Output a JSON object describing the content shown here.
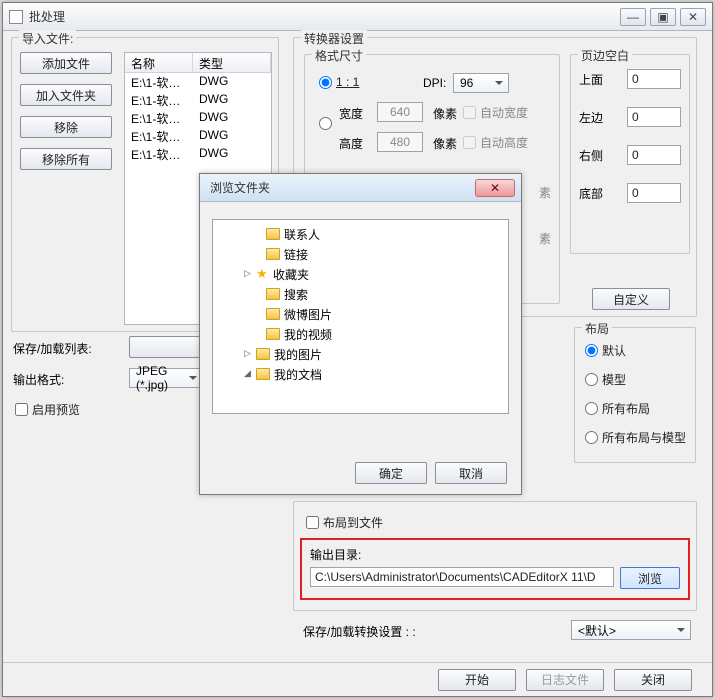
{
  "window": {
    "title": "批处理",
    "btn_min": "—",
    "btn_max": "▣",
    "btn_close": "✕"
  },
  "import": {
    "legend": "导入文件:",
    "btn_add_file": "添加文件",
    "btn_add_folder": "加入文件夹",
    "btn_remove": "移除",
    "btn_remove_all": "移除所有"
  },
  "table": {
    "col_name": "名称",
    "col_type": "类型",
    "rows": [
      {
        "name": "E:\\1-软文...",
        "type": "DWG"
      },
      {
        "name": "E:\\1-软文...",
        "type": "DWG"
      },
      {
        "name": "E:\\1-软文...",
        "type": "DWG"
      },
      {
        "name": "E:\\1-软文...",
        "type": "DWG"
      },
      {
        "name": "E:\\1-软文...",
        "type": "DWG"
      }
    ]
  },
  "save_list_label": "保存/加载列表:",
  "output_format_label": "输出格式:",
  "output_format_value": "JPEG (*.jpg)",
  "enable_preview": "启用预览",
  "converter": {
    "legend": "转换器设置",
    "format_legend": "格式尺寸",
    "ratio_1_1": "1 : 1",
    "dpi_label": "DPI:",
    "dpi_value": "96",
    "width_label": "宽度",
    "width_value": "640",
    "height_label": "高度",
    "height_value": "480",
    "pixel_label": "像素",
    "auto_width": "自动宽度",
    "auto_height": "自动高度",
    "px_suffix": "素",
    "margins_legend": "页边空白",
    "margin_top": "上面",
    "margin_left": "左边",
    "margin_right": "右侧",
    "margin_bottom": "底部",
    "margin_val": "0",
    "btn_custom": "自定义"
  },
  "layout": {
    "legend": "布局",
    "opt_default": "默认",
    "opt_model": "模型",
    "opt_all": "所有布局",
    "opt_all_model": "所有布局与模型"
  },
  "output": {
    "layout_to_file": "布局到文件",
    "dir_label": "输出目录:",
    "dir_value": "C:\\Users\\Administrator\\Documents\\CADEditorX 11\\D",
    "btn_browse": "浏览"
  },
  "save_settings_label": "保存/加载转换设置 : :",
  "save_settings_value": "<默认>",
  "bottom": {
    "btn_start": "开始",
    "btn_log": "日志文件",
    "btn_close": "关闭"
  },
  "dialog": {
    "title": "浏览文件夹",
    "btn_ok": "确定",
    "btn_cancel": "取消",
    "items": [
      {
        "indent": 38,
        "exp": "",
        "icon": "folder",
        "label": "联系人"
      },
      {
        "indent": 38,
        "exp": "",
        "icon": "folder",
        "label": "链接"
      },
      {
        "indent": 28,
        "exp": "▷",
        "icon": "star",
        "label": "收藏夹"
      },
      {
        "indent": 38,
        "exp": "",
        "icon": "folder",
        "label": "搜索"
      },
      {
        "indent": 38,
        "exp": "",
        "icon": "folder",
        "label": "微博图片"
      },
      {
        "indent": 38,
        "exp": "",
        "icon": "folder",
        "label": "我的视频"
      },
      {
        "indent": 28,
        "exp": "▷",
        "icon": "folder",
        "label": "我的图片"
      },
      {
        "indent": 28,
        "exp": "◢",
        "icon": "folder",
        "label": "我的文档"
      }
    ]
  }
}
